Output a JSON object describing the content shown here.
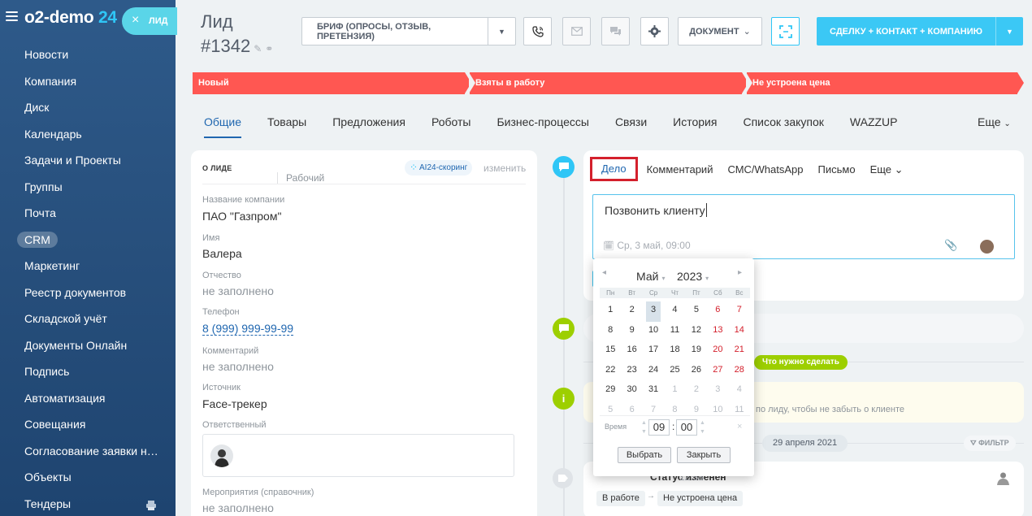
{
  "brand": {
    "name_part1": "o2-demo",
    "name_part2": "24"
  },
  "sidebar": {
    "items": [
      {
        "label": "Новости"
      },
      {
        "label": "Компания"
      },
      {
        "label": "Диск"
      },
      {
        "label": "Календарь"
      },
      {
        "label": "Задачи и Проекты"
      },
      {
        "label": "Группы"
      },
      {
        "label": "Почта"
      },
      {
        "label": "CRM"
      },
      {
        "label": "Маркетинг"
      },
      {
        "label": "Реестр документов"
      },
      {
        "label": "Складской учёт"
      },
      {
        "label": "Документы Онлайн"
      },
      {
        "label": "Подпись"
      },
      {
        "label": "Автоматизация"
      },
      {
        "label": "Совещания"
      },
      {
        "label": "Согласование заявки на ..."
      },
      {
        "label": "Объекты"
      },
      {
        "label": "Тендеры"
      }
    ],
    "active_index": 7
  },
  "lead_tab": {
    "close": "×",
    "label": "ЛИД"
  },
  "header": {
    "title": "Лид",
    "number": "#1342",
    "brief_button": "БРИФ (ОПРОСЫ, ОТЗЫВ, ПРЕТЕНЗИЯ)",
    "document_button": "ДОКУМЕНТ",
    "main_button": "СДЕЛКУ + КОНТАКТ + КОМПАНИЮ"
  },
  "stages": [
    {
      "label": "Новый"
    },
    {
      "label": "Взяты в работу"
    },
    {
      "label": "Не устроена цена"
    }
  ],
  "tabs": {
    "items": [
      "Общие",
      "Товары",
      "Предложения",
      "Роботы",
      "Бизнес-процессы",
      "Связи",
      "История",
      "Список закупок",
      "WAZZUP"
    ],
    "more": "Еще"
  },
  "lead_card": {
    "heading": "О ЛИДЕ",
    "ai_badge": "AI24-скоринг",
    "change_link": "изменить",
    "fields": {
      "company_label": "Название компании",
      "company_value": "ПАО \"Газпром\"",
      "name_label": "Имя",
      "name_value": "Валера",
      "patronymic_label": "Отчество",
      "patronymic_value": "не заполнено",
      "phone_label": "Телефон",
      "phone_value": "8 (999) 999-99-99",
      "phone_type": "Рабочий",
      "comment_label": "Комментарий",
      "comment_value": "не заполнено",
      "source_label": "Источник",
      "source_value": "Face-трекер",
      "responsible_label": "Ответственный",
      "events_label": "Мероприятия (справочник)",
      "events_value": "не заполнено"
    }
  },
  "editor": {
    "tabs": [
      "Дело",
      "Комментарий",
      "СМС/WhatsApp",
      "Письмо",
      "Еще"
    ],
    "text": "Позвонить клиенту",
    "date": "Ср, 3 май, 09:00"
  },
  "calendar": {
    "month": "Май",
    "year": "2023",
    "weekdays": [
      "Пн",
      "Вт",
      "Ср",
      "Чт",
      "Пт",
      "Сб",
      "Вс"
    ],
    "days": [
      {
        "d": "1"
      },
      {
        "d": "2"
      },
      {
        "d": "3",
        "today": true
      },
      {
        "d": "4"
      },
      {
        "d": "5"
      },
      {
        "d": "6",
        "we": true
      },
      {
        "d": "7",
        "we": true
      },
      {
        "d": "8"
      },
      {
        "d": "9"
      },
      {
        "d": "10"
      },
      {
        "d": "11"
      },
      {
        "d": "12"
      },
      {
        "d": "13",
        "we": true
      },
      {
        "d": "14",
        "we": true
      },
      {
        "d": "15"
      },
      {
        "d": "16"
      },
      {
        "d": "17"
      },
      {
        "d": "18"
      },
      {
        "d": "19"
      },
      {
        "d": "20",
        "we": true
      },
      {
        "d": "21",
        "we": true
      },
      {
        "d": "22"
      },
      {
        "d": "23"
      },
      {
        "d": "24"
      },
      {
        "d": "25"
      },
      {
        "d": "26"
      },
      {
        "d": "27",
        "we": true
      },
      {
        "d": "28",
        "we": true
      },
      {
        "d": "29"
      },
      {
        "d": "30"
      },
      {
        "d": "31"
      },
      {
        "d": "1",
        "oth": true
      },
      {
        "d": "2",
        "oth": true
      },
      {
        "d": "3",
        "oth": true
      },
      {
        "d": "4",
        "oth": true
      },
      {
        "d": "5",
        "oth": true
      },
      {
        "d": "6",
        "oth": true
      },
      {
        "d": "7",
        "oth": true
      },
      {
        "d": "8",
        "oth": true
      },
      {
        "d": "9",
        "oth": true
      },
      {
        "d": "10",
        "oth": true
      },
      {
        "d": "11",
        "oth": true
      }
    ],
    "time_label": "Время",
    "hour": "09",
    "minute": "00",
    "select_button": "Выбрать",
    "close_button": "Закрыть"
  },
  "timeline": {
    "todo_label": "Что нужно сделать",
    "info_text": "по лиду, чтобы не забыть о клиенте",
    "date_label": "29 апреля 2021",
    "filter_label": "ФИЛЬТР",
    "status_title": "Статус изменен",
    "status_time": "12:53",
    "status_from": "В работе",
    "status_to": "Не устроена цена"
  },
  "colors": {
    "accent": "#3bc8f5",
    "stage": "#ff5752",
    "link": "#2067b0",
    "highlight_border": "#d4202c",
    "todo": "#9dcf00"
  }
}
